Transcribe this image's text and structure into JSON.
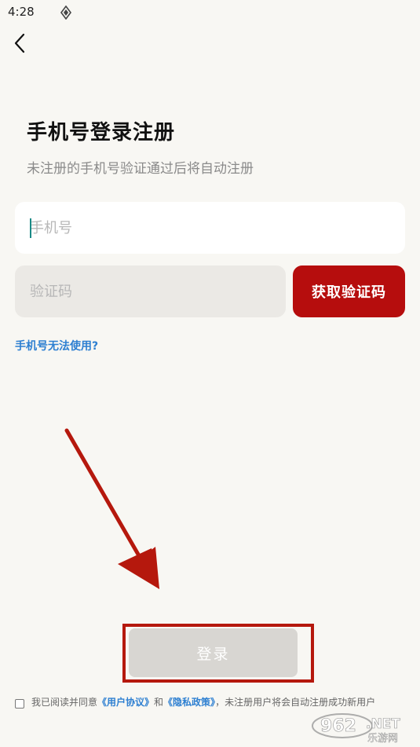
{
  "status_bar": {
    "time": "4:28"
  },
  "header": {
    "title": "手机号登录注册",
    "subtitle": "未注册的手机号验证通过后将自动注册"
  },
  "form": {
    "phone_placeholder": "手机号",
    "code_placeholder": "验证码",
    "get_code_label": "获取验证码",
    "help_link": "手机号无法使用?"
  },
  "login_label": "登录",
  "agreement": {
    "prefix": "我已阅读并同意",
    "user_agreement": "《用户协议》",
    "and": "和",
    "privacy_policy": "《隐私政策》",
    "suffix": "，未注册用户将会自动注册成功新用户"
  },
  "watermark": {
    "number": "962",
    "domain": ".NET",
    "site_name": "乐游网"
  },
  "colors": {
    "background": "#f8f7f3",
    "primary_red": "#b60d0d",
    "link_blue": "#2d7fd1",
    "annotation_red": "#b5180d",
    "disabled_button": "#d8d6d2"
  }
}
